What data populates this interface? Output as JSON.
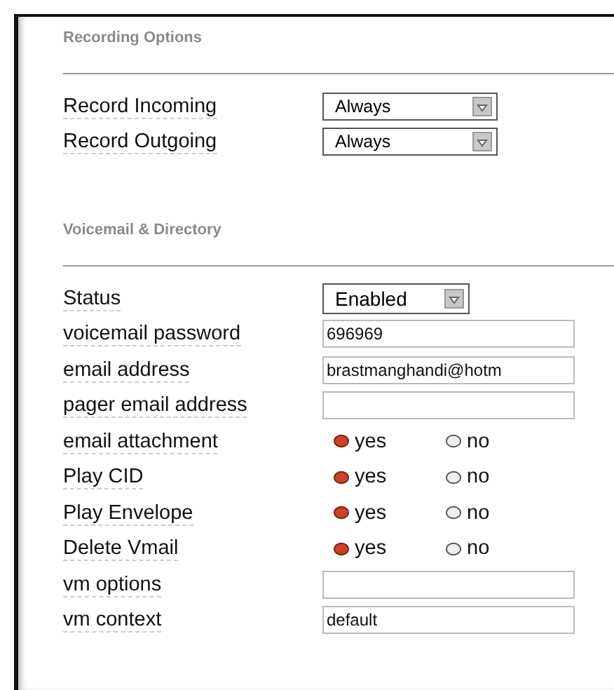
{
  "sections": [
    {
      "title": "Recording Options",
      "fields": [
        {
          "kind": "select",
          "label": "Record Incoming",
          "value": "Always"
        },
        {
          "kind": "select",
          "label": "Record Outgoing",
          "value": "Always"
        }
      ]
    },
    {
      "title": "Voicemail & Directory",
      "fields": [
        {
          "kind": "select",
          "label": "Status",
          "value": "Enabled"
        },
        {
          "kind": "text",
          "label": "voicemail password",
          "value": "696969"
        },
        {
          "kind": "text",
          "label": "email address",
          "value": "brastmanghandi@hotm"
        },
        {
          "kind": "text",
          "label": "pager email address"
        },
        {
          "kind": "radio",
          "label": "email attachment",
          "options": [
            {
              "label": "yes",
              "selected": true
            },
            {
              "label": "no",
              "selected": false
            }
          ]
        },
        {
          "kind": "radio",
          "label": "Play CID",
          "options": [
            {
              "label": "yes",
              "selected": true
            },
            {
              "label": "no",
              "selected": false
            }
          ]
        },
        {
          "kind": "radio",
          "label": "Play Envelope",
          "options": [
            {
              "label": "yes",
              "selected": true
            },
            {
              "label": "no",
              "selected": false
            }
          ]
        },
        {
          "kind": "radio",
          "label": "Delete Vmail",
          "options": [
            {
              "label": "yes",
              "selected": true
            },
            {
              "label": "no",
              "selected": false
            }
          ]
        },
        {
          "kind": "text",
          "label": "vm options"
        },
        {
          "kind": "text",
          "label": "vm context",
          "value": "default"
        }
      ]
    }
  ]
}
